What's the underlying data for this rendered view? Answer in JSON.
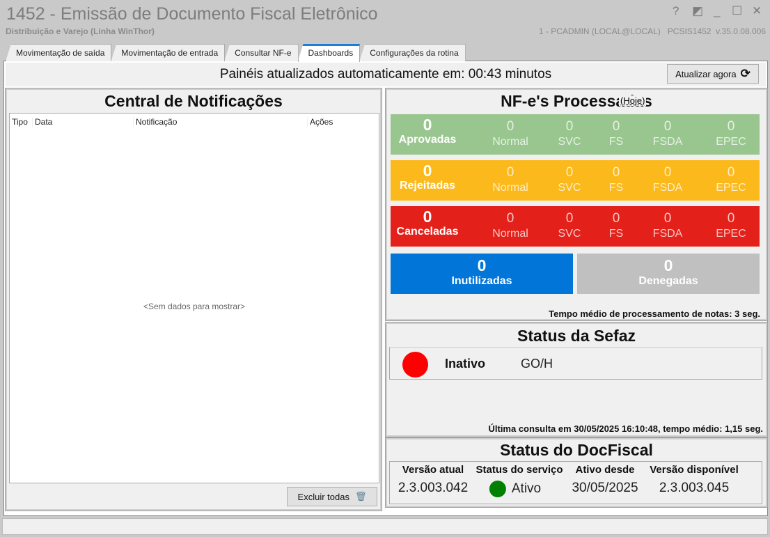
{
  "window": {
    "title": "1452 - Emissão de Documento Fiscal Eletrônico",
    "subtitle": "Distribuição e Varejo (Linha WinThor)",
    "user_info": "1 - PCADMIN (LOCAL@LOCAL)   PCSIS1452  v.35.0.08.006",
    "buttons": {
      "help": "?",
      "restore": "◩",
      "minimize": "_",
      "maximize": "☐",
      "close": "✕"
    }
  },
  "tabs": [
    {
      "label": "Movimentação de saída"
    },
    {
      "label": "Movimentação de entrada"
    },
    {
      "label": "Consultar NF-e"
    },
    {
      "label": "Dashboards",
      "active": true
    },
    {
      "label": "Configurações da rotina"
    }
  ],
  "toolbar": {
    "auto_text": "Painéis atualizados automaticamente em: 00:43 minutos",
    "refresh_label": "Atualizar agora"
  },
  "notifications": {
    "title": "Central de Notificações",
    "columns": [
      "Tipo",
      "Data",
      "Notificação",
      "Ações"
    ],
    "empty": "<Sem dados para mostrar>",
    "delete_all": "Excluir todas"
  },
  "nfe": {
    "title": "NF-e's Processadas",
    "overlay": "(Hoje)",
    "rows": [
      {
        "label": "Aprovadas",
        "total": "0",
        "color": "#99c68f",
        "cols": [
          {
            "v": "0",
            "l": "Normal"
          },
          {
            "v": "0",
            "l": "SVC"
          },
          {
            "v": "0",
            "l": "FS"
          },
          {
            "v": "0",
            "l": "FSDA"
          },
          {
            "v": "0",
            "l": "EPEC"
          }
        ]
      },
      {
        "label": "Rejeitadas",
        "total": "0",
        "color": "#fbb91c",
        "cols": [
          {
            "v": "0",
            "l": "Normal"
          },
          {
            "v": "0",
            "l": "SVC"
          },
          {
            "v": "0",
            "l": "FS"
          },
          {
            "v": "0",
            "l": "FSDA"
          },
          {
            "v": "0",
            "l": "EPEC"
          }
        ]
      },
      {
        "label": "Canceladas",
        "total": "0",
        "color": "#e3201a",
        "cols": [
          {
            "v": "0",
            "l": "Normal"
          },
          {
            "v": "0",
            "l": "SVC"
          },
          {
            "v": "0",
            "l": "FS"
          },
          {
            "v": "0",
            "l": "FSDA"
          },
          {
            "v": "0",
            "l": "EPEC"
          }
        ]
      }
    ],
    "inutilizadas": {
      "value": "0",
      "label": "Inutilizadas",
      "color": "#0275d8"
    },
    "denegadas": {
      "value": "0",
      "label": "Denegadas",
      "color": "#c0c0c0"
    },
    "tempo": "Tempo médio de processamento de notas: 3 seg."
  },
  "sefaz": {
    "title": "Status da Sefaz",
    "status": "Inativo",
    "status_color": "#ff0000",
    "uf": "GO/H",
    "ultima": "Última consulta em 30/05/2025 16:10:48, tempo médio: 1,15 seg."
  },
  "docfiscal": {
    "title": "Status do DocFiscal",
    "headers": [
      "Versão atual",
      "Status do serviço",
      "Ativo desde",
      "Versão disponível"
    ],
    "versao_atual": "2.3.003.042",
    "status": "Ativo",
    "status_color": "#008000",
    "ativo_desde": "30/05/2025",
    "versao_disponivel": "2.3.003.045"
  }
}
